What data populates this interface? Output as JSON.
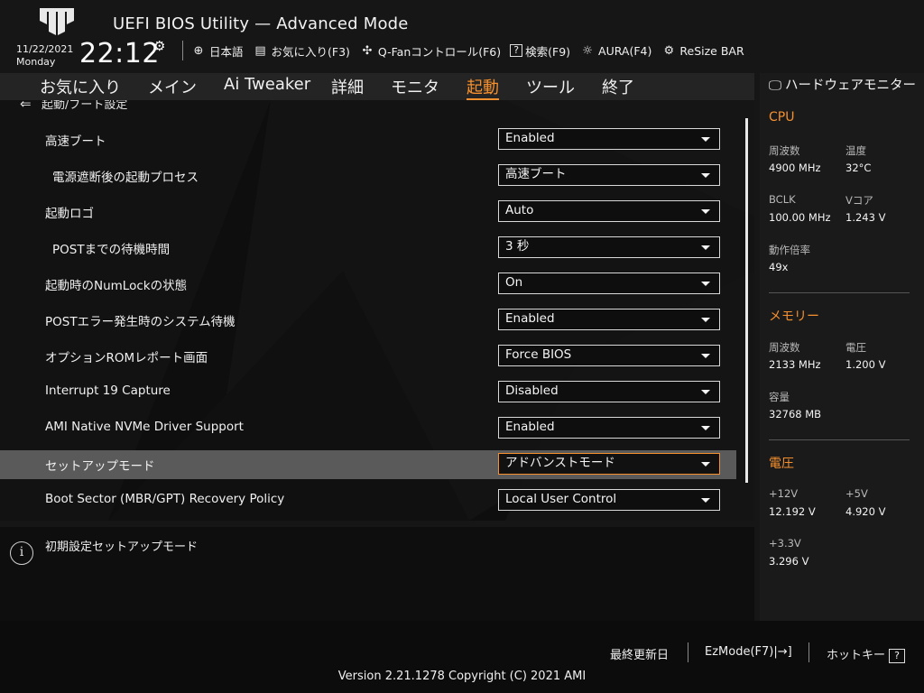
{
  "header": {
    "title": "UEFI BIOS Utility — Advanced Mode",
    "date": "11/22/2021",
    "weekday": "Monday",
    "time": "22:12",
    "toolbar": [
      {
        "icon": "globe-icon",
        "glyph": "⊕",
        "label": "日本語"
      },
      {
        "icon": "favorites-icon",
        "glyph": "▤",
        "label": "お気に入り(F3)"
      },
      {
        "icon": "fan-icon",
        "glyph": "✣",
        "label": "Q-Fanコントロール(F6)"
      },
      {
        "icon": "search-icon",
        "glyph": "?",
        "label": "検索(F9)"
      },
      {
        "icon": "aura-icon",
        "glyph": "☼",
        "label": "AURA(F4)"
      },
      {
        "icon": "resize-bar-icon",
        "glyph": "⚙",
        "label": "ReSize BAR"
      }
    ]
  },
  "menu": {
    "tabs": [
      "お気に入り",
      "メイン",
      "Ai Tweaker",
      "詳細",
      "モニタ",
      "起動",
      "ツール",
      "終了"
    ],
    "active": "起動"
  },
  "main": {
    "breadcrumb": "起動/ブート設定",
    "rows": [
      {
        "label": "高速ブート",
        "value": "Enabled",
        "indent": false
      },
      {
        "label": "電源遮断後の起動プロセス",
        "value": "高速ブート",
        "indent": true
      },
      {
        "label": "起動ロゴ",
        "value": "Auto",
        "indent": false
      },
      {
        "label": "POSTまでの待機時間",
        "value": "3 秒",
        "indent": true
      },
      {
        "label": "起動時のNumLockの状態",
        "value": "On",
        "indent": false
      },
      {
        "label": "POSTエラー発生時のシステム待機",
        "value": "Enabled",
        "indent": false
      },
      {
        "label": "オプションROMレポート画面",
        "value": "Force BIOS",
        "indent": false
      },
      {
        "label": "Interrupt 19 Capture",
        "value": "Disabled",
        "indent": false
      },
      {
        "label": "AMI Native NVMe Driver Support",
        "value": "Enabled",
        "indent": false
      },
      {
        "label": "セットアップモード",
        "value": "アドバンストモード",
        "indent": false,
        "selected": true
      },
      {
        "label": "Boot Sector (MBR/GPT) Recovery Policy",
        "value": "Local User Control",
        "indent": false
      }
    ]
  },
  "help": {
    "text": "初期設定セットアップモード"
  },
  "hw_monitor": {
    "title": "ハードウェアモニター",
    "cpu": {
      "heading": "CPU",
      "freq_label": "周波数",
      "freq": "4900 MHz",
      "temp_label": "温度",
      "temp": "32°C",
      "bclk_label": "BCLK",
      "bclk": "100.00 MHz",
      "vcore_label": "Vコア",
      "vcore": "1.243 V",
      "ratio_label": "動作倍率",
      "ratio": "49x"
    },
    "memory": {
      "heading": "メモリー",
      "freq_label": "周波数",
      "freq": "2133 MHz",
      "volt_label": "電圧",
      "volt": "1.200 V",
      "cap_label": "容量",
      "cap": "32768 MB"
    },
    "voltage": {
      "heading": "電圧",
      "v12_label": "+12V",
      "v12": "12.192 V",
      "v5_label": "+5V",
      "v5": "4.920 V",
      "v33_label": "+3.3V",
      "v33": "3.296 V"
    }
  },
  "footer": {
    "last_modified": "最終更新日",
    "ezmode": "EzMode(F7)|",
    "hotkey": "ホットキー",
    "version": "Version 2.21.1278 Copyright (C) 2021 AMI"
  },
  "colors": {
    "accent": "#f5902e",
    "selected_row": "#5a5a5a"
  }
}
